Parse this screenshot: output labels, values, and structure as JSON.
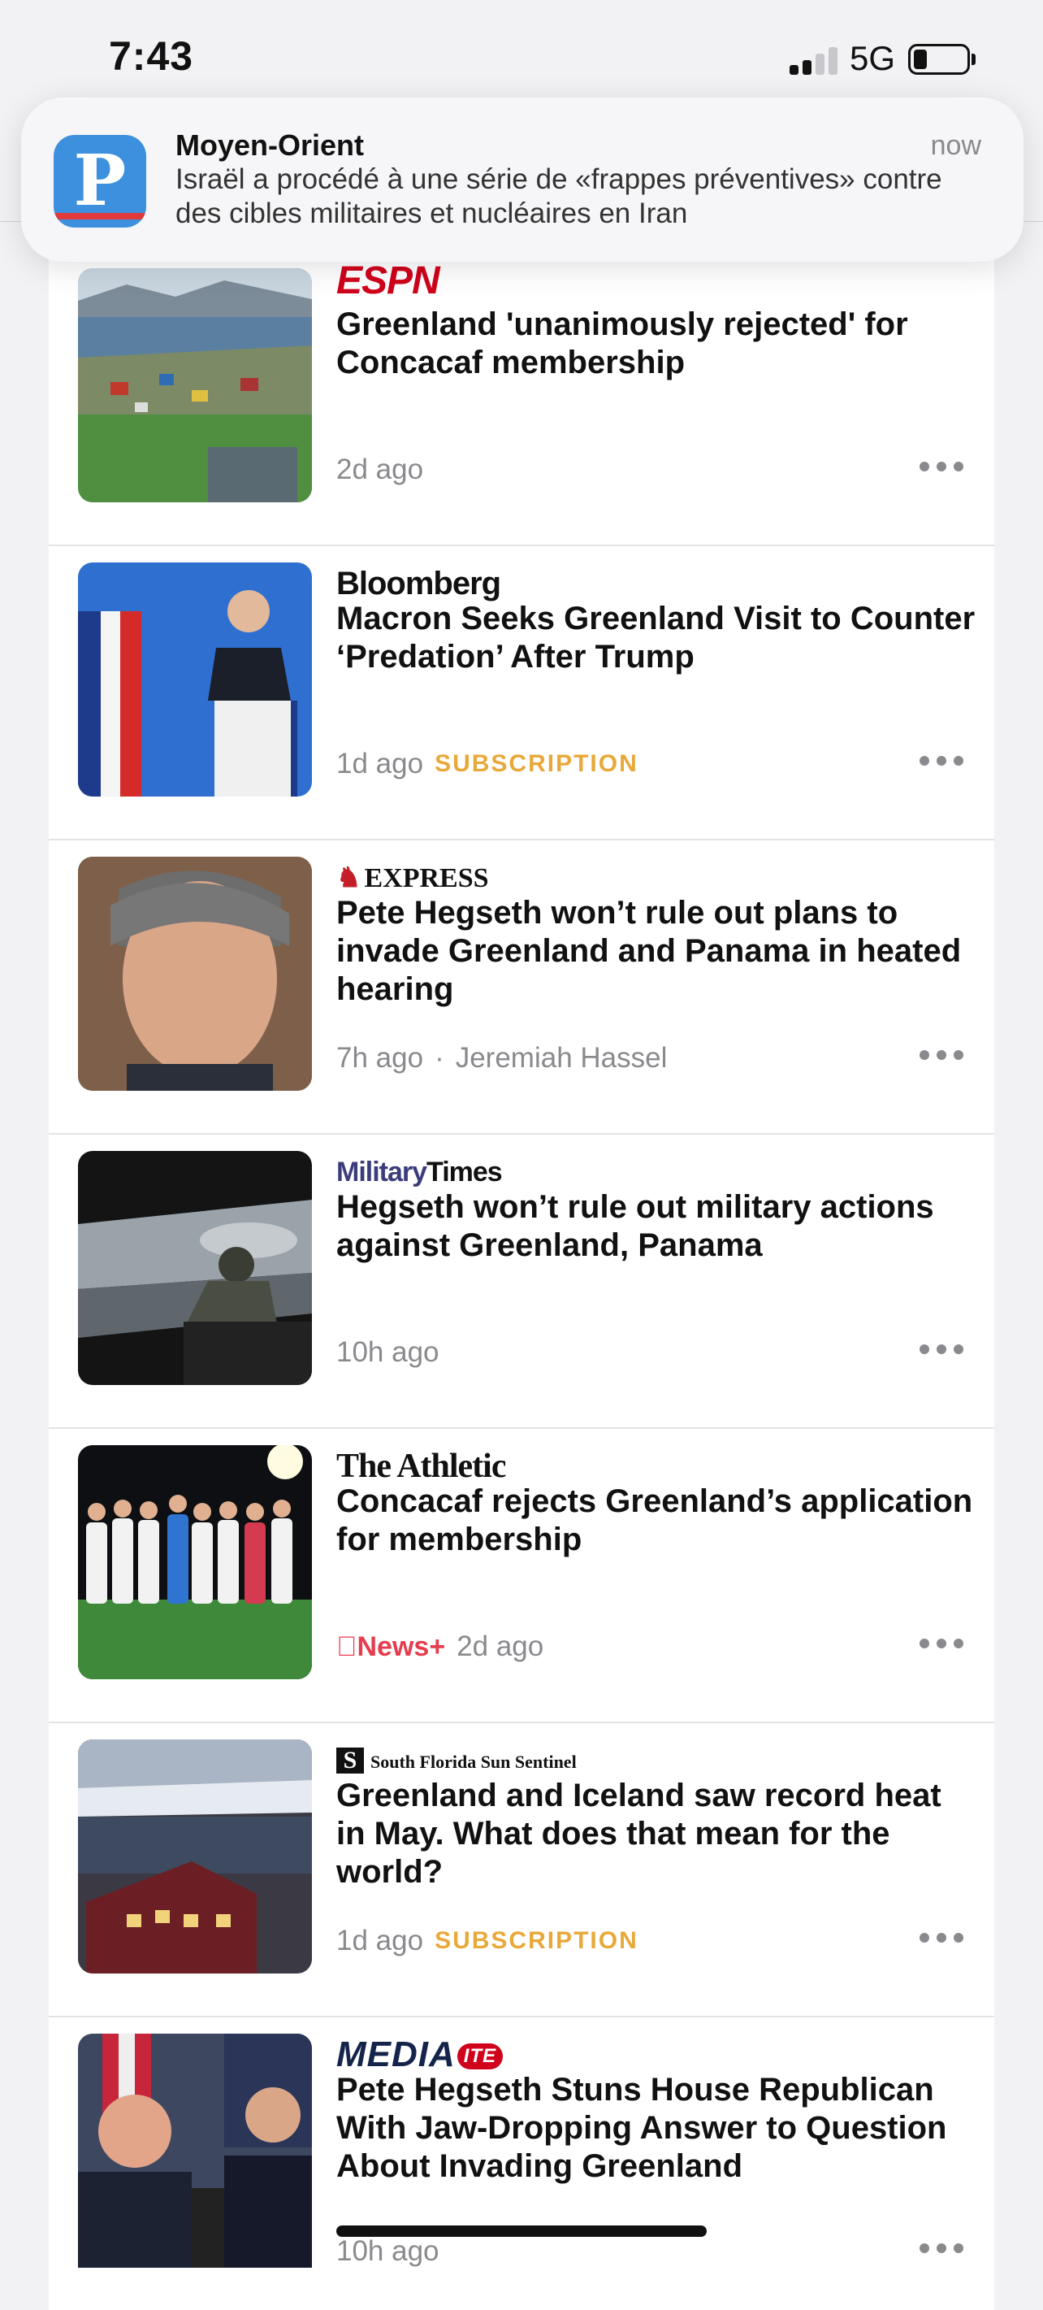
{
  "status_bar": {
    "time": "7:43",
    "network": "5G"
  },
  "notification": {
    "app_icon": "P",
    "title": "Moyen-Orient",
    "time": "now",
    "body": "Israël a procédé à une série de «frappes préventives» contre des cibles militaires et nucléaires en Iran"
  },
  "feed": [
    {
      "publisher": "ESPN",
      "headline": "Greenland 'unanimously rejected' for Concacaf membership",
      "time": "2d ago",
      "badge": "",
      "author": "",
      "thumb": "coastal-town-soccer-field"
    },
    {
      "publisher": "Bloomberg",
      "headline": "Macron Seeks Greenland Visit to Counter ‘Predation’ After Trump",
      "time": "1d ago",
      "badge": "SUBSCRIPTION",
      "author": "",
      "thumb": "macron-podium"
    },
    {
      "publisher": "EXPRESS",
      "headline": "Pete Hegseth won’t rule out plans to invade Greenland and Panama in heated hearing",
      "time": "7h ago",
      "separator": "·",
      "author": "Jeremiah Hassel",
      "badge": "",
      "thumb": "hegseth-portrait"
    },
    {
      "publisher_a": "Military",
      "publisher_b": "Times",
      "headline": "Hegseth won’t rule out military actions against Greenland, Panama",
      "time": "10h ago",
      "badge": "",
      "author": "",
      "thumb": "soldier-aircraft"
    },
    {
      "publisher": "The Athletic",
      "headline": "Concacaf rejects Greenland’s application for membership",
      "news_plus": "News+",
      "time": "2d ago",
      "badge": "",
      "author": "",
      "thumb": "soccer-team"
    },
    {
      "publisher_s": "S",
      "publisher": "South Florida Sun Sentinel",
      "headline": "Greenland and Iceland saw record heat in May. What does that mean for the world?",
      "time": "1d ago",
      "badge": "SUBSCRIPTION",
      "author": "",
      "thumb": "arctic-house"
    },
    {
      "publisher": "MEDIA",
      "publisher_tag": "ITE",
      "headline": "Pete Hegseth Stuns House Republican With Jaw-Dropping Answer to Question About Invading Greenland",
      "time": "10h ago",
      "badge": "",
      "author": "",
      "thumb": "hearing-collage"
    }
  ],
  "colors": {
    "subscription": "#e8a93a",
    "news_plus": "#e53d4f",
    "espn": "#d0021b",
    "notif_icon": "#3d90de"
  }
}
